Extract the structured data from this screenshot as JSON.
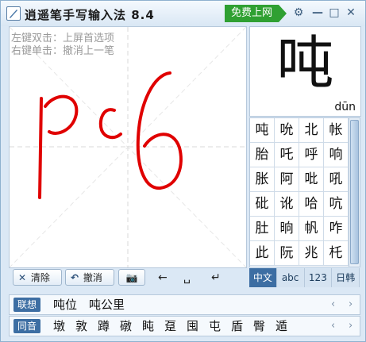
{
  "title": "逍遥笔手写输入法 8.4",
  "free_online": "免费上网",
  "window_controls": {
    "settings": "⚙",
    "minimize": "—",
    "maximize": "□",
    "close": "✕"
  },
  "hints": [
    "左键双击：上屏首选项",
    "右键单击：撤消上一笔"
  ],
  "toolbar": {
    "clear_label": "清除",
    "undo_label": "撤消",
    "camera": "📷",
    "left": "←",
    "space": "␣",
    "enter": "↵"
  },
  "preview": {
    "char": "吨",
    "pinyin": "dūn"
  },
  "candidates": [
    "吨",
    "吮",
    "北",
    "帐",
    "胎",
    "吒",
    "呼",
    "响",
    "胀",
    "阿",
    "吡",
    "吼",
    "砒",
    "讹",
    "哈",
    "吭",
    "肚",
    "晌",
    "帆",
    "咋",
    "此",
    "阮",
    "兆",
    "杔"
  ],
  "modes": [
    {
      "label": "中文",
      "active": true
    },
    {
      "label": "abc",
      "active": false
    },
    {
      "label": "123",
      "active": false
    },
    {
      "label": "日韩",
      "active": false
    }
  ],
  "association": {
    "tag": "联想",
    "words": [
      "吨位",
      "吨公里"
    ]
  },
  "homophone": {
    "tag": "同音",
    "words": [
      "墩",
      "敦",
      "蹲",
      "礅",
      "盹",
      "趸",
      "囤",
      "屯",
      "盾",
      "臀",
      "遁"
    ]
  },
  "nav": {
    "prev": "‹",
    "next": "›"
  },
  "accent_colors": {
    "green": "#2fa032",
    "blue": "#3d6ea3",
    "stroke": "#e00000"
  }
}
